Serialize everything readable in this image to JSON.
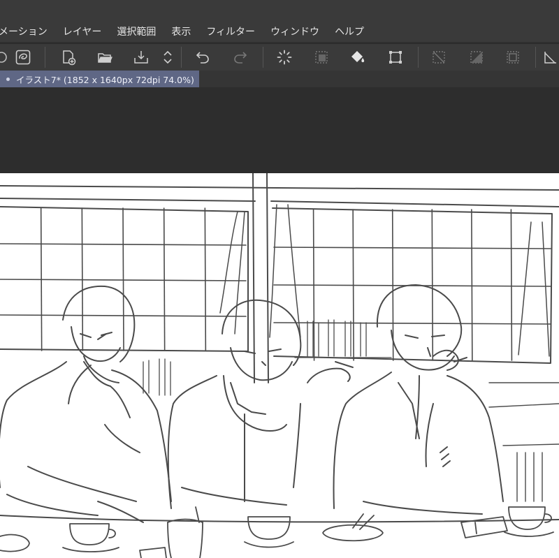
{
  "menubar": {
    "items": [
      "メーション",
      "レイヤー",
      "選択範囲",
      "表示",
      "フィルター",
      "ウィンドウ",
      "ヘルプ"
    ]
  },
  "toolbar": {
    "icons": [
      "lasso-icon",
      "new-file-icon",
      "open-folder-icon",
      "save-download-icon",
      "up-down-arrows-icon",
      "undo-icon",
      "redo-icon",
      "loading-spinner-icon",
      "select-layer-icon",
      "fill-bucket-icon",
      "transform-icon",
      "clear-selection-icon",
      "invert-selection-icon",
      "selection-border-icon",
      "crop-icon"
    ]
  },
  "document": {
    "tab_label": "イラスト7* (1852 x 1640px 72dpi 74.0%)"
  },
  "colors": {
    "menubar_bg": "#3a3a3a",
    "tab_active_bg": "#5f6785",
    "workspace_bg": "#2d2d2d",
    "canvas_bg": "#ffffff",
    "sketch_line": "#4a4a4a"
  }
}
